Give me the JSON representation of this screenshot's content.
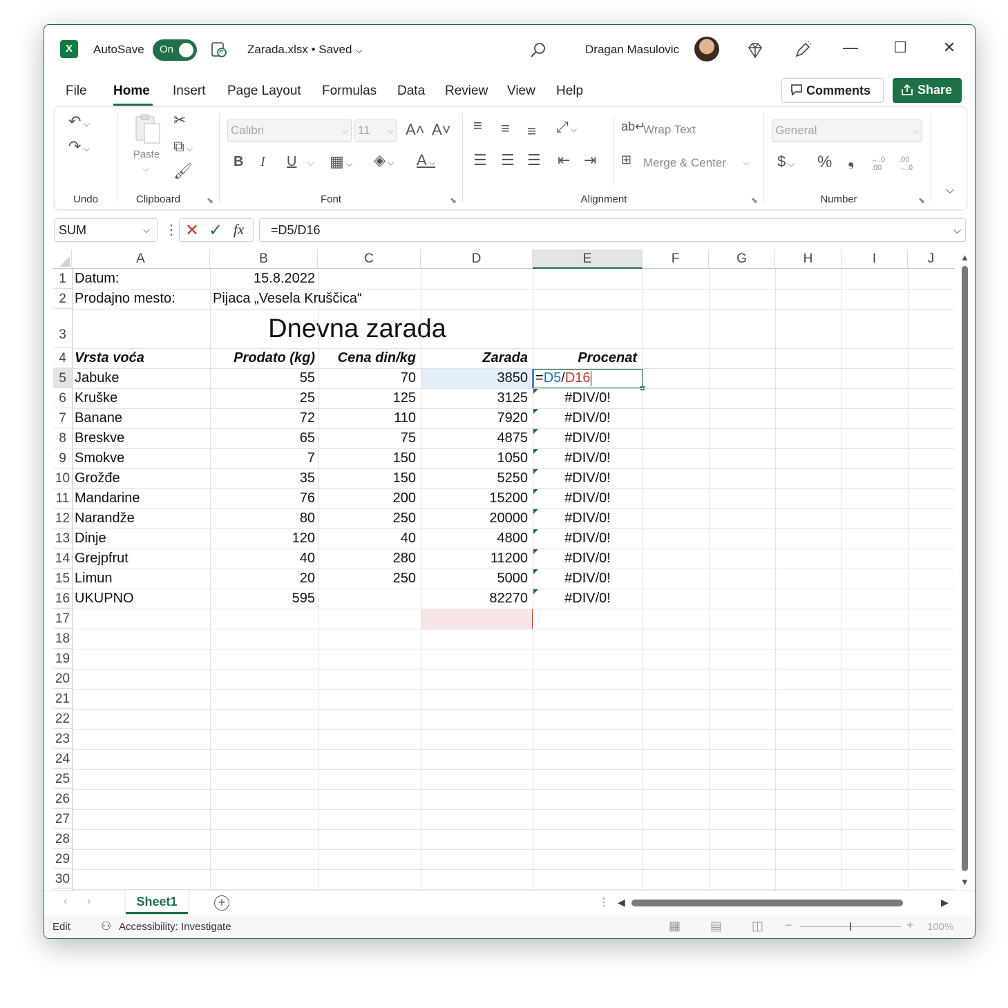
{
  "titlebar": {
    "app_logo": "X",
    "autosave_label": "AutoSave",
    "autosave_state": "On",
    "file_title": "Zarada.xlsx • Saved",
    "user_name": "Dragan Masulovic",
    "minimize_glyph": "—",
    "maximize_glyph": "☐",
    "close_glyph": "✕"
  },
  "tabs": [
    "File",
    "Home",
    "Insert",
    "Page Layout",
    "Formulas",
    "Data",
    "Review",
    "View",
    "Help"
  ],
  "buttons": {
    "comments": "Comments",
    "share": "Share"
  },
  "ribbon": {
    "groups": {
      "undo": "Undo",
      "clipboard": "Clipboard",
      "font": "Font",
      "alignment": "Alignment",
      "number": "Number"
    },
    "paste": "Paste",
    "font_name": "Calibri",
    "font_size": "11",
    "wrap_text": "Wrap Text",
    "merge_center": "Merge & Center",
    "number_format": "General",
    "bold": "B",
    "italic": "I",
    "underline": "U",
    "grow_font": "A˄",
    "shrink_font": "A˅",
    "currency": "$",
    "percent": "%",
    "comma": "❟",
    "inc_decimal": "←.0 .00",
    "dec_decimal": ".00 →.0"
  },
  "formula_bar": {
    "name_box": "SUM",
    "fx": "fx",
    "formula": "=D5/D16"
  },
  "columns": [
    "A",
    "B",
    "C",
    "D",
    "E",
    "F",
    "G",
    "H",
    "I",
    "J"
  ],
  "rows": [
    "1",
    "2",
    "3",
    "4",
    "5",
    "6",
    "7",
    "8",
    "9",
    "10",
    "11",
    "12",
    "13",
    "14",
    "15",
    "16",
    "17",
    "18",
    "19",
    "20",
    "21",
    "22",
    "23",
    "24",
    "25",
    "26",
    "27",
    "28",
    "29",
    "30"
  ],
  "sheet": {
    "datum_label": "Datum:",
    "datum_value": "15.8.2022",
    "mesto_label": "Prodajno mesto:",
    "mesto_value": "Pijaca „Vesela Kruščica“",
    "title": "Dnevna zarada",
    "headers": [
      "Vrsta voća",
      "Prodato (kg)",
      "Cena din/kg",
      "Zarada",
      "Procenat"
    ],
    "data": [
      [
        "Jabuke",
        "55",
        "70",
        "3850",
        ""
      ],
      [
        "Kruške",
        "25",
        "125",
        "3125",
        "#DIV/0!"
      ],
      [
        "Banane",
        "72",
        "110",
        "7920",
        "#DIV/0!"
      ],
      [
        "Breskve",
        "65",
        "75",
        "4875",
        "#DIV/0!"
      ],
      [
        "Smokve",
        "7",
        "150",
        "1050",
        "#DIV/0!"
      ],
      [
        "Grožđe",
        "35",
        "150",
        "5250",
        "#DIV/0!"
      ],
      [
        "Mandarine",
        "76",
        "200",
        "15200",
        "#DIV/0!"
      ],
      [
        "Narandže",
        "80",
        "250",
        "20000",
        "#DIV/0!"
      ],
      [
        "Dinje",
        "120",
        "40",
        "4800",
        "#DIV/0!"
      ],
      [
        "Grejpfrut",
        "40",
        "280",
        "11200",
        "#DIV/0!"
      ],
      [
        "Limun",
        "20",
        "250",
        "5000",
        "#DIV/0!"
      ]
    ],
    "total": [
      "UKUPNO",
      "595",
      "",
      "82270",
      "#DIV/0!"
    ],
    "edit_formula": {
      "eq": "=",
      "ref1": "D5",
      "op": "/",
      "ref2": "D16"
    }
  },
  "sheet_tab": "Sheet1",
  "status": {
    "mode": "Edit",
    "accessibility": "Accessibility: Investigate",
    "zoom": "100%"
  },
  "colors": {
    "accent": "#1e7145",
    "ref_blue": "#1f6fb2",
    "ref_red": "#c0392b"
  }
}
